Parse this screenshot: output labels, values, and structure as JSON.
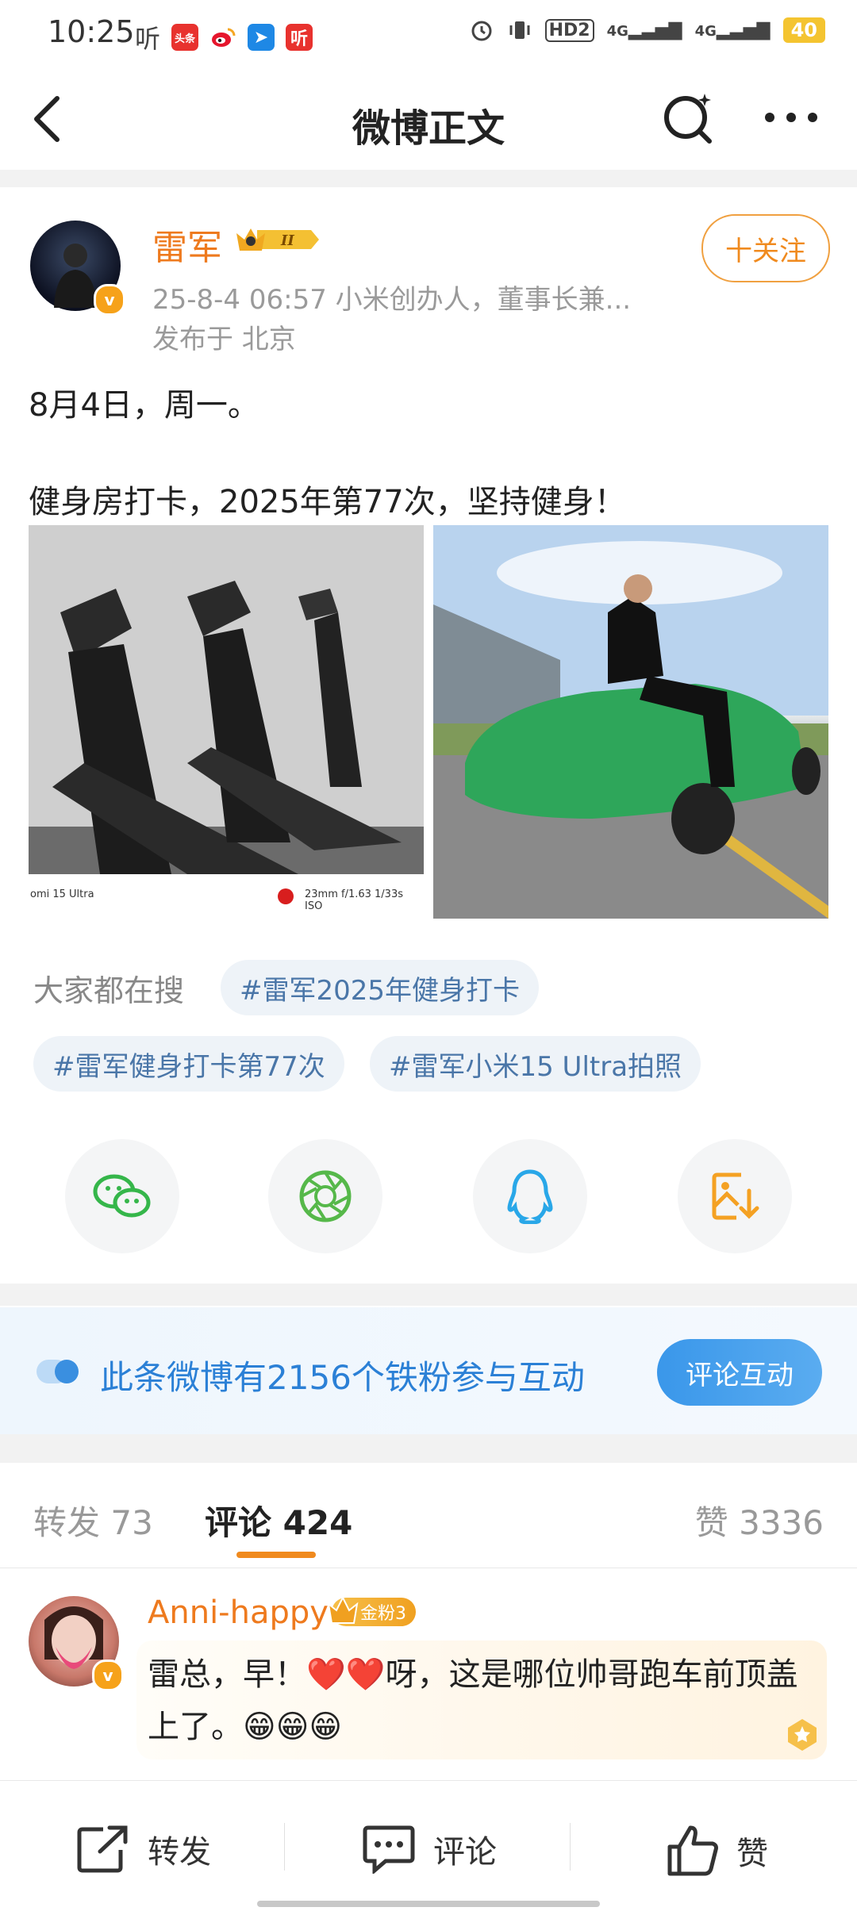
{
  "status_bar": {
    "time": "10:25",
    "left_icons": [
      "听",
      "头条",
      "微博",
      "导航",
      "听"
    ],
    "right_icons": [
      "alarm-icon",
      "vibrate-icon",
      "HD2",
      "4G",
      "4G"
    ],
    "battery": "40"
  },
  "nav": {
    "title": "微博正文",
    "back_icon": "chevron-left-icon",
    "search_icon": "search-icon",
    "more_icon": "more-dots-icon"
  },
  "post": {
    "author": "雷军",
    "level_badge": "II",
    "meta": "25-8-4 06:57  小米创办人，董事长兼...",
    "location": "发布于 北京",
    "follow_label": "十关注",
    "text_line1": "8月4日，周一。",
    "text_line2": "健身房打卡，2025年第77次，坚持健身！",
    "image1_caption_left": "omi 15 Ultra",
    "image1_caption_right": "23mm  f/1.63  1/33s  ISO",
    "image1_alt": "gym treadmills",
    "image2_alt": "man sitting on green car hood"
  },
  "hot_search": {
    "label": "大家都在搜",
    "tags": [
      "#雷军2025年健身打卡",
      "#雷军健身打卡第77次",
      "#雷军小米15 Ultra拍照"
    ]
  },
  "share": {
    "items": [
      "wechat-icon",
      "moments-icon",
      "qq-icon",
      "save-image-icon"
    ]
  },
  "banner": {
    "text": "此条微博有2156个铁粉参与互动",
    "button": "评论互动"
  },
  "tabs": {
    "repost": "转发 73",
    "comment": "评论 424",
    "like": "赞 3336"
  },
  "comment": {
    "user": "Anni-happy",
    "fan_badge": "金粉3",
    "text": "雷总，早！❤️❤️呀，这是哪位帅哥跑车前顶盖上了。😁😁😁"
  },
  "bottom_bar": {
    "repost": "转发",
    "comment": "评论",
    "like": "赞"
  }
}
